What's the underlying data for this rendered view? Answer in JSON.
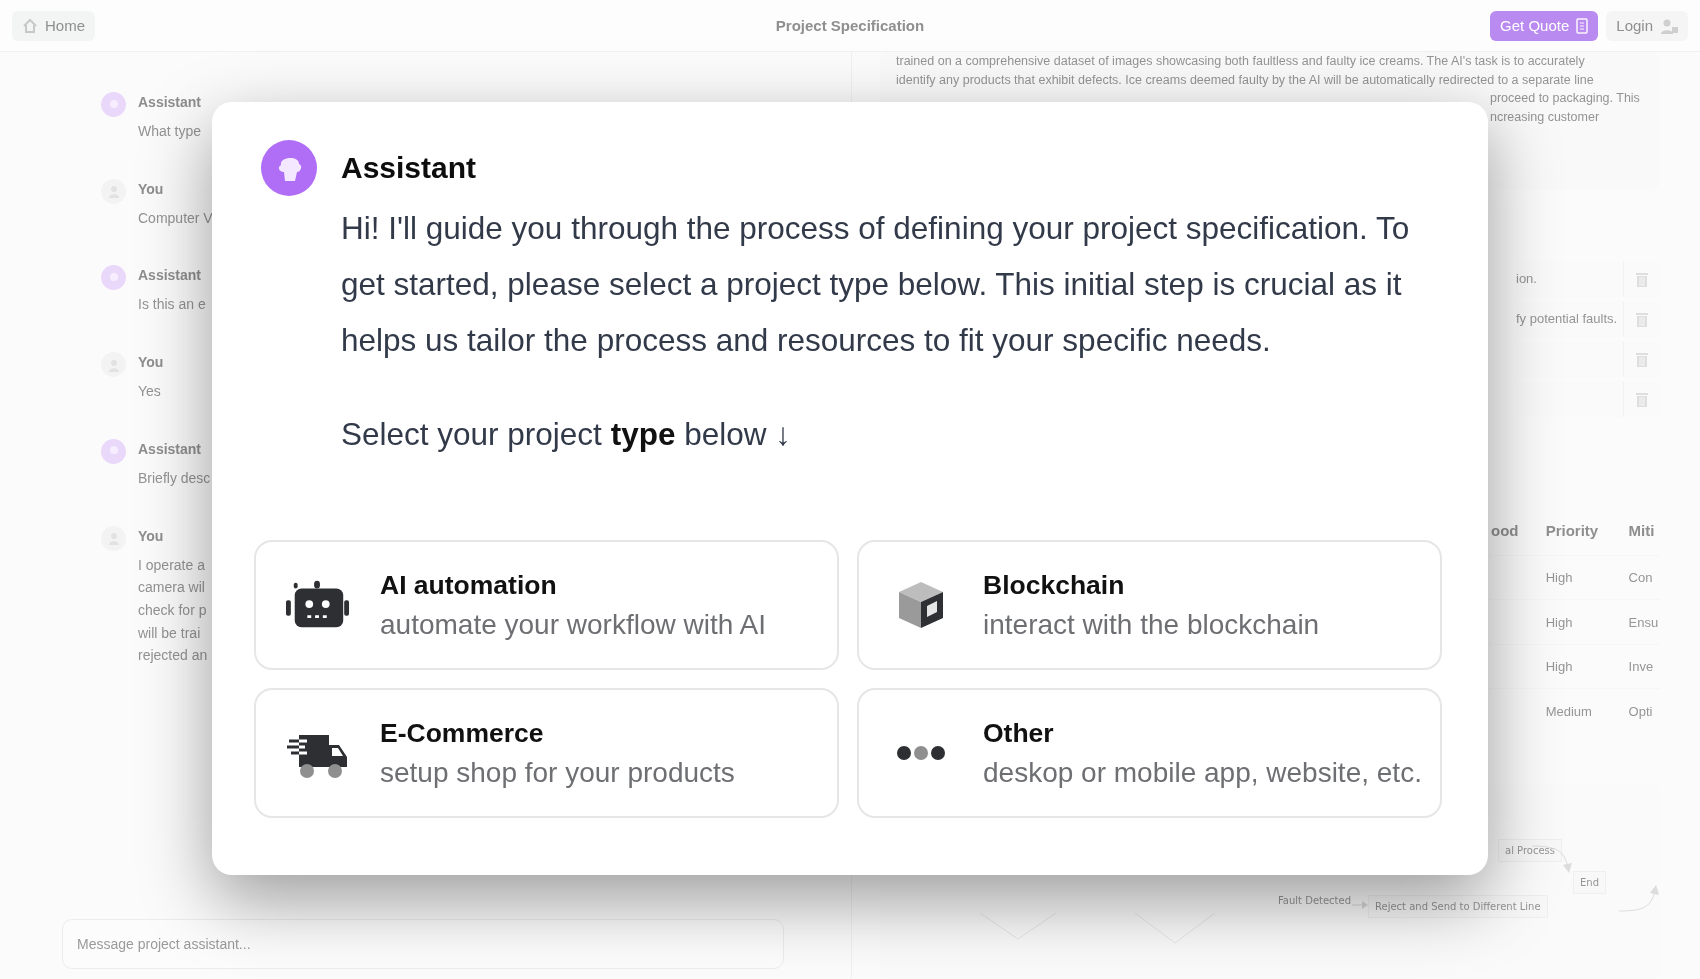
{
  "top_bar": {
    "home": "Home",
    "title": "Project Specification",
    "get_quote": "Get Quote",
    "login": "Login"
  },
  "chat": {
    "messages": [
      {
        "kind": "assistant",
        "author": "Assistant",
        "lines": [
          "What type"
        ]
      },
      {
        "kind": "user",
        "author": "You",
        "lines": [
          "Computer V"
        ]
      },
      {
        "kind": "assistant",
        "author": "Assistant",
        "lines": [
          "Is this an e"
        ]
      },
      {
        "kind": "user",
        "author": "You",
        "lines": [
          "Yes"
        ]
      },
      {
        "kind": "assistant",
        "author": "Assistant",
        "lines": [
          "Briefly desc"
        ]
      },
      {
        "kind": "user",
        "author": "You",
        "lines": [
          "I operate a",
          "camera wil",
          "check for p",
          "will be trai",
          "rejected an"
        ]
      }
    ],
    "input": {
      "placeholder": "Message project assistant..."
    }
  },
  "spec": {
    "description_lines": [
      "trained on a comprehensive dataset of images showcasing both faultless and faulty ice creams. The AI's task is to accurately",
      "identify any products that exhibit defects. Ice creams deemed faulty by the AI will be automatically redirected to a separate line"
    ],
    "description_fragments": [
      "proceed to packaging. This",
      "ncreasing customer"
    ],
    "requirements": [
      {
        "kind": "text",
        "text": "ion."
      },
      {
        "kind": "text",
        "text": "fy potential faults."
      },
      {
        "kind": "blank"
      },
      {
        "kind": "blank"
      }
    ],
    "table": {
      "columns": [
        "ood",
        "Priority",
        "Miti"
      ],
      "rows": [
        [
          "",
          "High",
          "Con"
        ],
        [
          "",
          "High",
          "Ensu"
        ],
        [
          "",
          "High",
          "Inve"
        ],
        [
          "",
          "Medium",
          "Opti"
        ]
      ]
    },
    "flow": {
      "nodes": [
        {
          "kind": "process",
          "label": "al Process"
        },
        {
          "kind": "end",
          "label": "End"
        },
        {
          "kind": "edge",
          "label": "Fault Detected"
        },
        {
          "kind": "process",
          "label": "Reject and Send to Different Line"
        }
      ]
    }
  },
  "modal": {
    "author": "Assistant",
    "message": "Hi! I'll guide you through the process of defining your project specification. To get started, please select a project type below. This initial step is crucial as it helps us tailor the process and resources to fit your specific needs.",
    "prompt": "Select your project **type** below ↓",
    "options": [
      {
        "kind": "ai",
        "title": "AI automation",
        "subtitle": "automate your workflow with AI"
      },
      {
        "kind": "blockchain",
        "title": "Blockchain",
        "subtitle": "interact with the blockchain"
      },
      {
        "kind": "ecommerce",
        "title": "E-Commerce",
        "subtitle": "setup shop for your products"
      },
      {
        "kind": "other",
        "title": "Other",
        "subtitle": "deskop or mobile app, website, etc."
      }
    ]
  }
}
